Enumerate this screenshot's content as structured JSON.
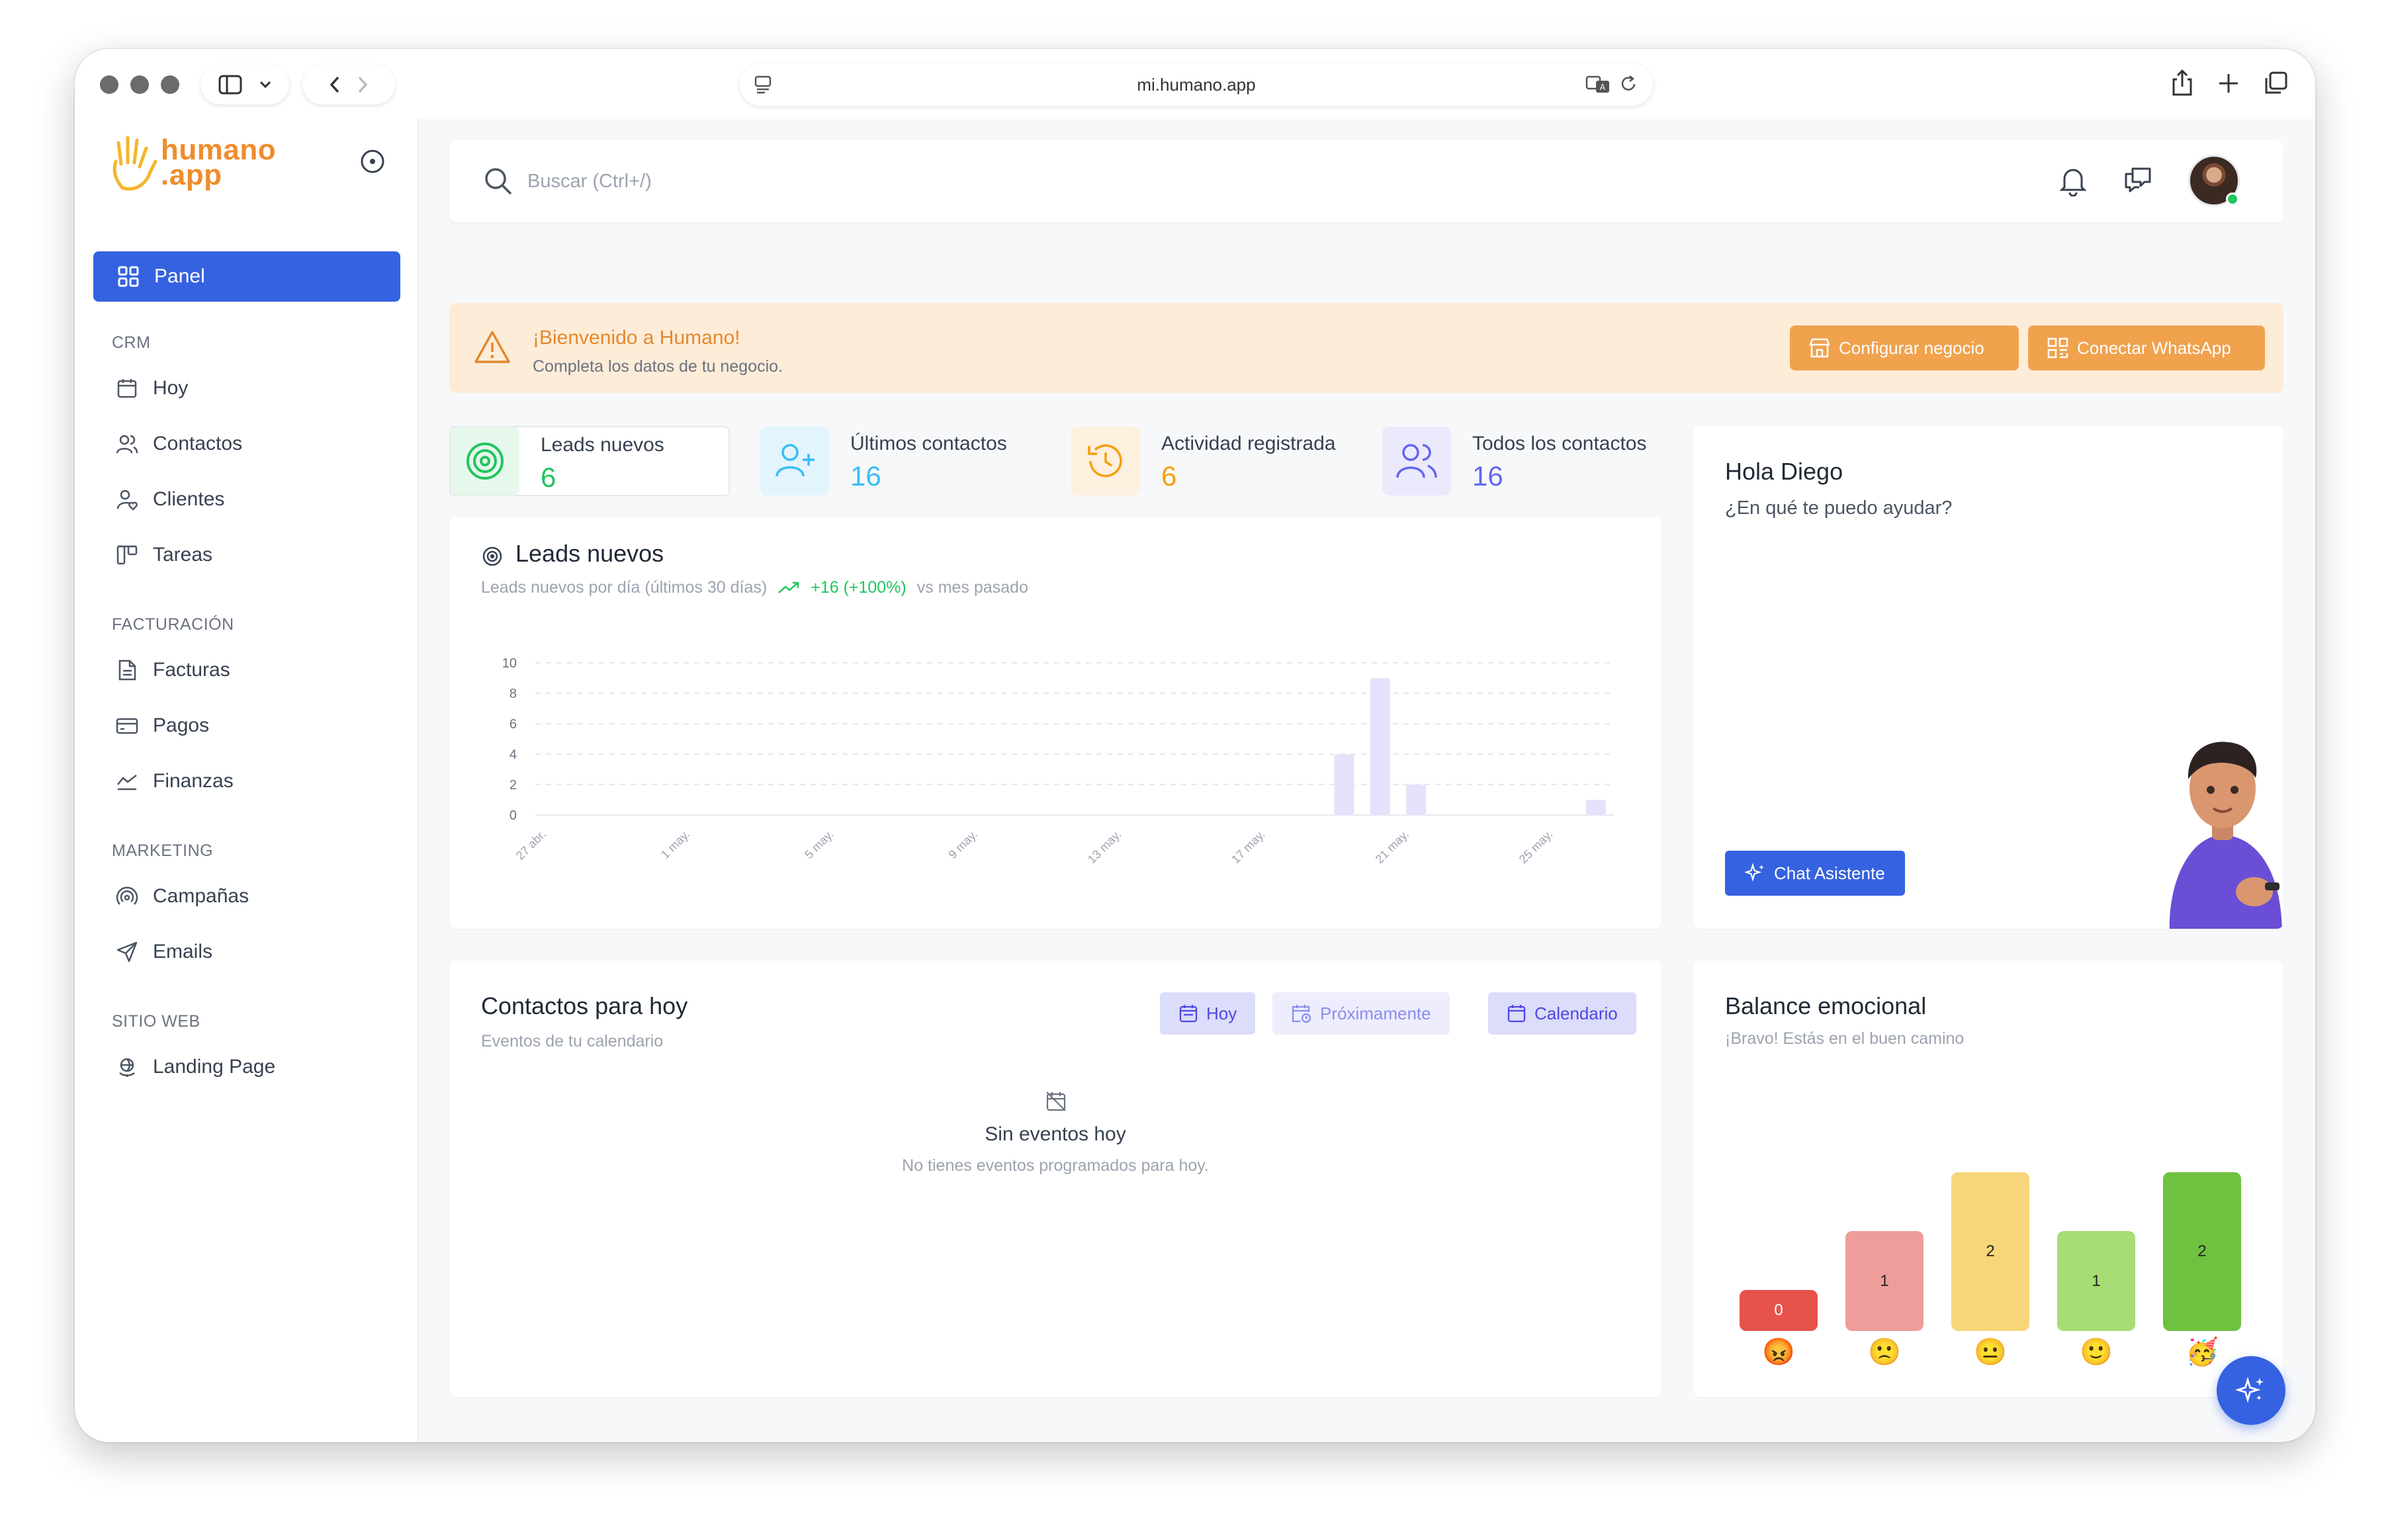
{
  "browser": {
    "url": "mi.humano.app"
  },
  "sidebar": {
    "logo": {
      "line1": "humano",
      "line2": ".app"
    },
    "active": "Panel",
    "sections": [
      {
        "title": "CRM",
        "items": [
          "Hoy",
          "Contactos",
          "Clientes",
          "Tareas"
        ]
      },
      {
        "title": "FACTURACIÓN",
        "items": [
          "Facturas",
          "Pagos",
          "Finanzas"
        ]
      },
      {
        "title": "MARKETING",
        "items": [
          "Campañas",
          "Emails"
        ]
      },
      {
        "title": "SITIO WEB",
        "items": [
          "Landing Page"
        ]
      }
    ]
  },
  "search": {
    "placeholder": "Buscar (Ctrl+/)"
  },
  "banner": {
    "title": "¡Bienvenido a Humano!",
    "subtitle": "Completa los datos de tu negocio.",
    "btn_configure": "Configurar negocio",
    "btn_whatsapp": "Conectar WhatsApp"
  },
  "stats": [
    {
      "label": "Leads nuevos",
      "value": "6",
      "color": "#22c55e"
    },
    {
      "label": "Últimos contactos",
      "value": "16",
      "color": "#38bdf8"
    },
    {
      "label": "Actividad registrada",
      "value": "6",
      "color": "#f59e0b"
    },
    {
      "label": "Todos los contactos",
      "value": "16",
      "color": "#6366f1"
    }
  ],
  "leads_card": {
    "title": "Leads nuevos",
    "subtitle": "Leads nuevos por día (últimos 30 días)",
    "trend": "+16 (+100%)",
    "trend_suffix": "vs mes pasado"
  },
  "chart_data": {
    "type": "bar",
    "title": "Leads nuevos",
    "ylim": [
      0,
      10
    ],
    "yticks": [
      0,
      2,
      4,
      6,
      8,
      10
    ],
    "xticks": [
      "27 abr.",
      "1 may.",
      "5 may.",
      "9 may.",
      "13 may.",
      "17 may.",
      "21 may.",
      "25 may."
    ],
    "grid": true,
    "bars": [
      {
        "day_offset": 22,
        "value": 4
      },
      {
        "day_offset": 23,
        "value": 9
      },
      {
        "day_offset": 24,
        "value": 2
      },
      {
        "day_offset": 29,
        "value": 1
      }
    ]
  },
  "assistant": {
    "greeting": "Hola Diego",
    "question": "¿En qué te puedo ayudar?",
    "button": "Chat Asistente"
  },
  "contacts_today": {
    "title": "Contactos para hoy",
    "subtitle": "Eventos de tu calendario",
    "tabs": [
      "Hoy",
      "Próximamente",
      "Calendario"
    ],
    "empty_title": "Sin eventos hoy",
    "empty_text": "No tienes eventos programados para hoy."
  },
  "emotional": {
    "title": "Balance emocional",
    "subtitle": "¡Bravo! Estás en el buen camino",
    "bars": [
      {
        "value": 0,
        "emoji": "😡",
        "color": "#e5534b"
      },
      {
        "value": 1,
        "emoji": "🙁",
        "color": "#ee9d9a"
      },
      {
        "value": 2,
        "emoji": "😐",
        "color": "#f7d679"
      },
      {
        "value": 1,
        "emoji": "🙂",
        "color": "#a6dd74"
      },
      {
        "value": 2,
        "emoji": "🥳",
        "color": "#6fc13f"
      }
    ]
  }
}
